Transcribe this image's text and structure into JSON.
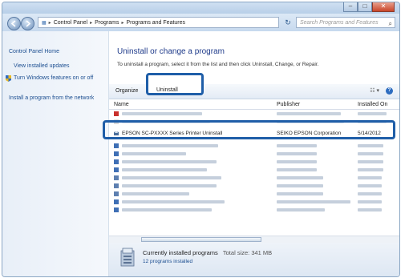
{
  "window": {
    "minimize": "–",
    "maximize": "□",
    "close": "✕"
  },
  "address": {
    "crumbs": [
      "Control Panel",
      "Programs",
      "Programs and Features"
    ],
    "separator": "▸",
    "search_placeholder": "Search Programs and Features",
    "refresh": "↻",
    "search_icon": "⌕"
  },
  "sidebar": {
    "items": [
      {
        "label": "Control Panel Home"
      },
      {
        "label": "View installed updates"
      },
      {
        "label": "Turn Windows features on or off"
      },
      {
        "label": "Install a program from the network"
      }
    ]
  },
  "main": {
    "heading": "Uninstall or change a program",
    "description": "To uninstall a program, select it from the list and then click Uninstall, Change, or Repair."
  },
  "toolbar": {
    "organize": "Organize",
    "uninstall": "Uninstall",
    "views": "☷ ▾",
    "help": "?"
  },
  "columns": {
    "name": "Name",
    "publisher": "Publisher",
    "installed_on": "Installed On"
  },
  "selected_row": {
    "name": "EPSON SC-PXXXX Series Printer Uninstall",
    "publisher": "SEIKO EPSON Corporation",
    "installed_on": "5/14/2012"
  },
  "status": {
    "line1_label": "Currently installed programs",
    "line1_total": "Total size: 341 MB",
    "line2": "12 programs installed"
  },
  "colors": {
    "highlight": "#1f5ea8",
    "link": "#1d4f91"
  }
}
